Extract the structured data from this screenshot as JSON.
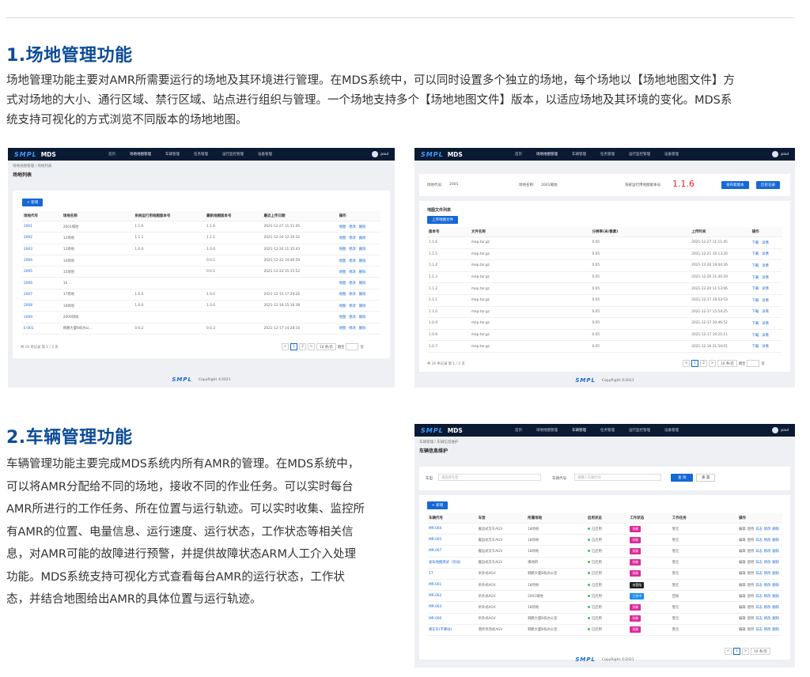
{
  "sections": [
    {
      "title": "1.场地管理功能",
      "paragraph": [
        "场地管理功能主要对AMR所需要运行的场地及其环境进行管理。在MDS系统中，可以同时设置多个独立的场地，每个场地以【场地地图文件】方",
        "式对场地的大小、通行区域、禁行区域、站点进行组织与管理。一个场地支持多个【场地地图文件】版本，以适应场地及其环境的变化。MDS系",
        "统支持可视化的方式浏览不同版本的场地地图。"
      ]
    },
    {
      "title": "2.车辆管理功能",
      "paragraph": [
        "车辆管理功能主要完成MDS系统内所有AMR的管理。在MDS系统中，",
        "可以将AMR分配给不同的场地，接收不同的作业任务。可以实时每台",
        "AMR所进行的工作任务、所在位置与运行轨迹。可以实时收集、监控所",
        "有AMR的位置、电量信息、运行速度、运行状态，工作状态等相关信",
        "息，对AMR可能的故障进行预警，并提供故障状态ARM人工介入处理",
        "功能。MDS系统支持可视化方式查看每台AMR的运行状态，工作状",
        "态，并结合地图给出AMR的具体位置与运行轨迹。"
      ]
    }
  ],
  "app": {
    "logo": "SMPL",
    "name": "MDS",
    "user": "paul",
    "nav": [
      "首页",
      "场地地图管理",
      "车辆管理",
      "任务管理",
      "运行监控管理",
      "设备管理"
    ],
    "copyright": "CopyRight ©2021",
    "footer_logo": "SMPL"
  },
  "site_list": {
    "breadcrumb": "场地地图管理 / 场地列表",
    "title": "场地列表",
    "new_button": "+ 新增",
    "columns": [
      "场地代号",
      "场地名称",
      "系统运行用地图版本号",
      "最新地图版本号",
      "最近上传日期",
      "操作"
    ],
    "rows": [
      [
        "2001",
        "2001場地",
        "1.1.6",
        "1.1.6",
        "2021-12-27 11:11:45"
      ],
      [
        "2002",
        "12场地",
        "1.1.1",
        "1.1.1",
        "2021-12-20 12:30:32"
      ],
      [
        "2003",
        "13场地",
        "1.0.0",
        "1.0.0",
        "2021-12-20 11:35:43"
      ],
      [
        "2004",
        "14场地",
        "",
        "0.0.1",
        "2021-12-22 14:40:59"
      ],
      [
        "2005",
        "15场地",
        "",
        "0.0.1",
        "2021-12-22 15:15:52"
      ],
      [
        "2006",
        "16 ...",
        "",
        "",
        ""
      ],
      [
        "2007",
        "17场地",
        "1.0.0",
        "1.0.0",
        "2021-12-15 17:29:26"
      ],
      [
        "2008",
        "18场地",
        "1.0.0",
        "1.0.0",
        "2021-12-16 15:16:38"
      ],
      [
        "2009",
        "2009场地",
        "",
        "",
        ""
      ],
      [
        "E-001",
        "韩鹏大厦B栋办公...",
        "0.0.2",
        "0.0.3",
        "2021-12-17 14:28:16"
      ]
    ],
    "ops": [
      "地图",
      "修改",
      "删除"
    ],
    "total": "共 10 条记录 第 1 / 2 页",
    "pages": [
      "<",
      "1",
      "2",
      ">"
    ],
    "page_size": "10 条/页",
    "goto": "跳至",
    "page_unit": "页"
  },
  "map_files": {
    "site_code_label": "场地代号:",
    "site_code": "2001",
    "site_name_label": "场地名称:",
    "site_name": "2001場地",
    "version_label": "系统运行用地图版本号:",
    "version": "1.1.6",
    "publish_button": "发布新版本",
    "history_button": "历史记录",
    "list_title": "地图文件列表",
    "upload_button": "上传地图文件",
    "columns": [
      "版本号",
      "文件名称",
      "分辨率(米/像素)",
      "上传时间",
      "操作"
    ],
    "rows": [
      [
        "1.1.6",
        "map.tar.gz",
        "0.05",
        "2021-12-27 11:11:45"
      ],
      [
        "1.1.5",
        "map.tar.gz",
        "0.05",
        "2021-12-21 16:13:20"
      ],
      [
        "1.1.4",
        "map.tar.gz",
        "0.05",
        "2021-12-20 19:44:26"
      ],
      [
        "1.1.3",
        "map.tar.gz",
        "0.05",
        "2021-12-20 11:20:29"
      ],
      [
        "1.1.2",
        "map.tar.gz",
        "0.05",
        "2021-12-20 11:13:06"
      ],
      [
        "1.1.1",
        "map.tar.gz",
        "0.05",
        "2021-12-17 16:53:53"
      ],
      [
        "1.1.0",
        "map.tar.gz",
        "0.05",
        "2021-12-17 15:54:25"
      ],
      [
        "1.0.9",
        "map.tar.gz",
        "0.05",
        "2021-12-17 10:46:52"
      ],
      [
        "1.0.8",
        "map.tar.gz",
        "0.05",
        "2021-12-17 10:21:11"
      ],
      [
        "1.0.7",
        "map.tar.gz",
        "0.05",
        "2021-12-16 21:54:01"
      ]
    ],
    "ops": [
      "下载",
      "详情"
    ],
    "total": "共 16 条记录 第 1 / 2 页",
    "pages": [
      "<",
      "1",
      "2",
      ">"
    ],
    "page_size": "10 条/页",
    "goto": "跳至",
    "page_unit": "页"
  },
  "vehicles": {
    "breadcrumb": "车辆管理 / 车辆信息维护",
    "title": "车辆信息维护",
    "type_label": "车型:",
    "type_placeholder": "请选择车型",
    "code_label": "车辆代号:",
    "code_placeholder": "请输入车辆代号",
    "search_button": "查 询",
    "reset_button": "重 置",
    "new_button": "+ 新增",
    "columns": [
      "车辆代号",
      "车型",
      "所属场地",
      "启用状态",
      "工作状态",
      "工作任务",
      "操作"
    ],
    "rows": [
      [
        "MR-004",
        "搬运式叉车AGV",
        "18场地",
        "已启用",
        "失联",
        "暂无"
      ],
      [
        "MR-005",
        "搬运式叉车AGV",
        "18场地",
        "已启用",
        "失联",
        "暂无"
      ],
      [
        "MR-007",
        "搬运式叉车AGV",
        "18场地",
        "已启用",
        "失联",
        "暂无"
      ],
      [
        "发布地图测试（勿动）",
        "搬运式叉车AGV",
        "場地四",
        "已启用",
        "失联",
        "暂无"
      ],
      [
        "17",
        "举升式AGV",
        "韩鹏大厦B栋办公室",
        "已启用",
        "失联",
        "暂无"
      ],
      [
        "MR-001",
        "举升式AGV",
        "18场地",
        "已启用",
        "未登陆",
        "暂无"
      ],
      [
        "MR-002",
        "举升式AGV",
        "2001場地",
        "已启用",
        "工作中",
        "回家"
      ],
      [
        "MR-003",
        "举升式AGV",
        "18场地",
        "已启用",
        "失联",
        "暂无"
      ],
      [
        "MR-006",
        "举升式AGV",
        "韩鹏大厦B栋办公室",
        "已启用",
        "失联",
        "暂无"
      ],
      [
        "真实车(不要动)",
        "潜伏举顶式AGV",
        "韩鹏大厦B栋办公室",
        "已启用",
        "失联",
        "暂无"
      ]
    ],
    "ops": [
      "编辑",
      "使用",
      "日志",
      "修改",
      "删除"
    ],
    "status_colors": {
      "失联": "#e0299a",
      "未登陆": "#222222",
      "工作中": "#1a8ff0"
    },
    "pages": [
      "<",
      "1",
      ">"
    ],
    "page_size": "10 条/页"
  }
}
